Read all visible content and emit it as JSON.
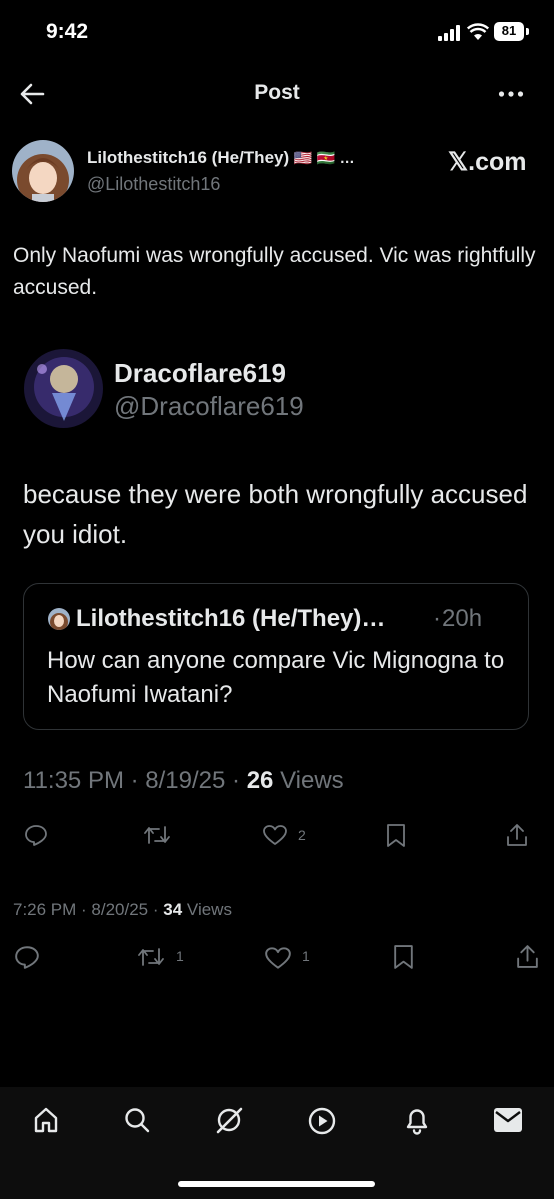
{
  "status_bar": {
    "time": "9:42",
    "battery": "81"
  },
  "header": {
    "title": "Post"
  },
  "post": {
    "author_name": "Lilothestitch16 (He/They)",
    "author_flags": "🇺🇸 🇸🇷 …",
    "author_handle": "@Lilothestitch16",
    "source_label": "𝕏.com",
    "text": "Only Naofumi was wrongfully accused. Vic was rightfully accused.",
    "time": "7:26 PM",
    "date": "8/20/25",
    "views_count": "34",
    "views_label": "Views",
    "actions": {
      "retweets": "1",
      "likes": "1"
    }
  },
  "embedded": {
    "author_name": "Dracoflare619",
    "author_handle": "@Dracoflare619",
    "text": "because they were both wrongfully accused you idiot.",
    "quote": {
      "author_name": "Lilothestitch16 (He/They)…",
      "age": "20h",
      "text": "How can anyone compare Vic Mignogna to Naofumi Iwatani?"
    },
    "time": "11:35 PM",
    "date": "8/19/25",
    "views_count": "26",
    "views_label": "Views",
    "actions": {
      "likes": "2"
    }
  },
  "tabbar": [
    "home-icon",
    "search-icon",
    "grok-icon",
    "video-icon",
    "notifications-icon",
    "messages-icon"
  ]
}
